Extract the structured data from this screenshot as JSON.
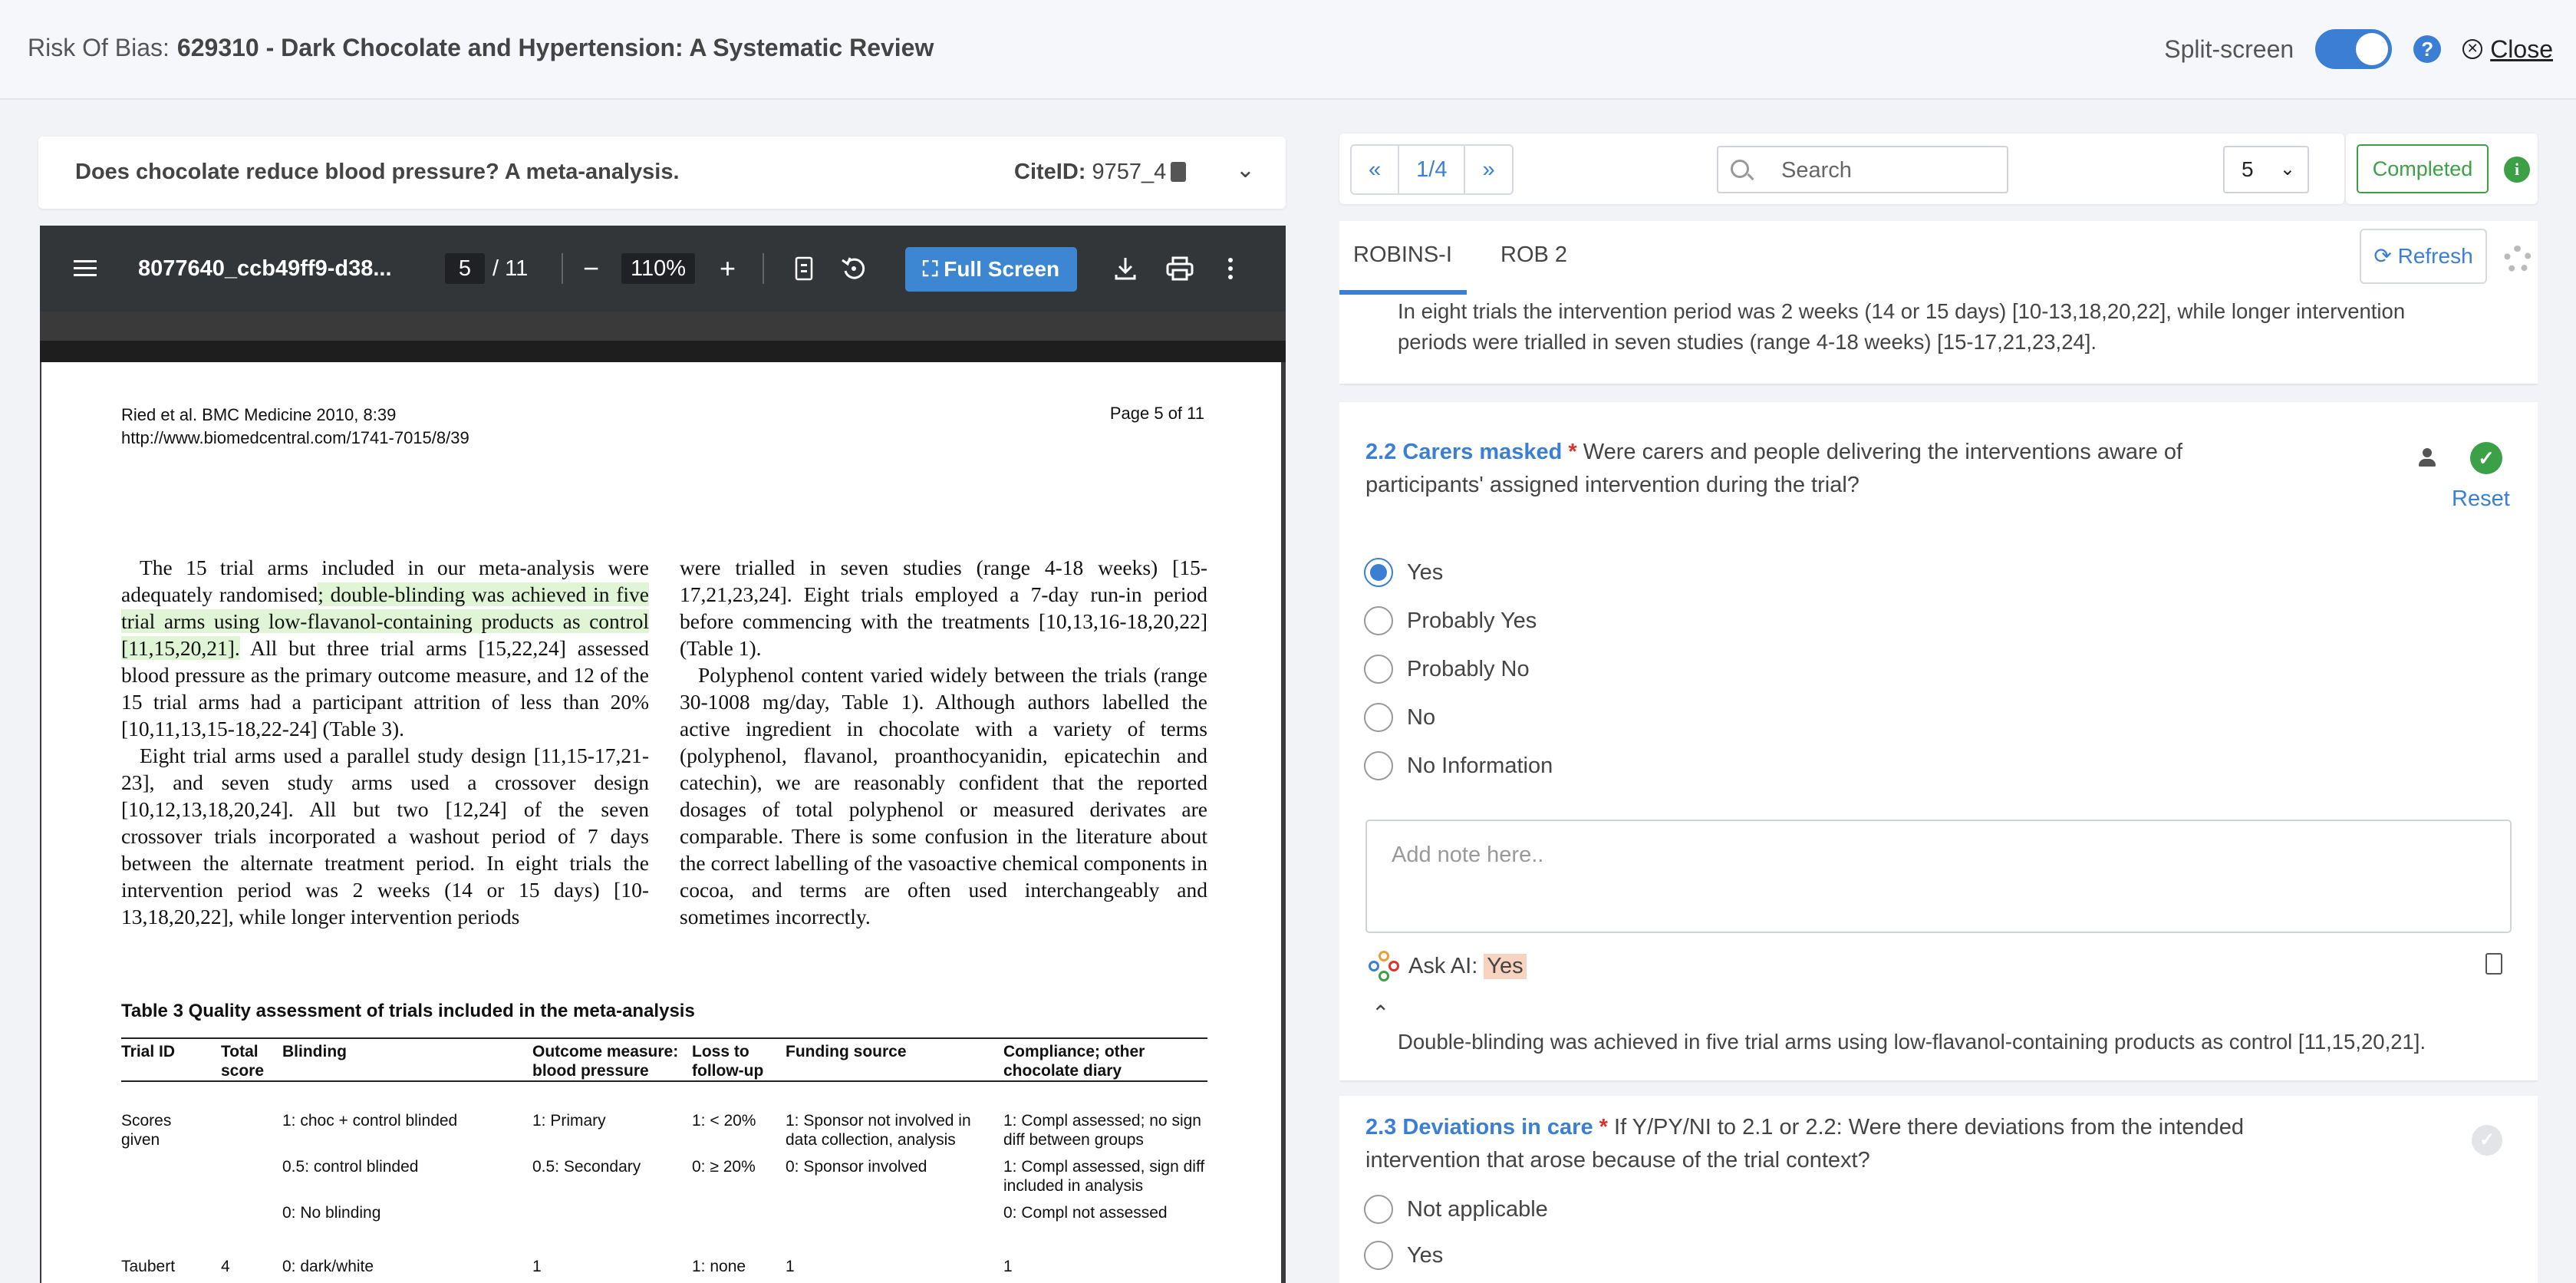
{
  "header": {
    "prefix": "Risk Of Bias:",
    "title": "629310 - Dark Chocolate and Hypertension: A Systematic Review",
    "split_label": "Split-screen",
    "help_glyph": "?",
    "close_label": "Close"
  },
  "citation": {
    "title": "Does chocolate reduce blood pressure? A meta-analysis.",
    "cite_label": "CiteID:",
    "cite_id": "9757_4"
  },
  "pdf": {
    "filename": "8077640_ccb49ff9-d38...",
    "page": "5",
    "total": "/ 11",
    "zoom": "110%",
    "fullscreen_label": "Full Screen",
    "page_header_l1": "Ried et al. BMC Medicine 2010, 8:39",
    "page_header_l2": "http://www.biomedcentral.com/1741-7015/8/39",
    "page_header_r": "Page 5 of 11",
    "col1_a": "The 15 trial arms included in our meta-analysis were adequately randomised",
    "col1_hl": "; double-blinding was achieved in five trial arms using low-flavanol-containing products as control [11,15,20,21].",
    "col1_b": " All but three trial arms [15,22,24] assessed blood pressure as the primary outcome measure, and 12 of the 15 trial arms had a participant attrition of less than 20% [10,11,13,15-18,22-24] (Table 3).",
    "col1_p2": "Eight trial arms used a parallel study design [11,15-17,21-23], and seven study arms used a crossover design [10,12,13,18,20,24]. All but two [12,24] of the seven crossover trials incorporated a washout period of 7 days between the alternate treatment period. In eight trials the intervention period was 2 weeks (14 or 15 days) [10-13,18,20,22], while longer intervention periods",
    "col2_p1": "were trialled in seven studies (range 4-18 weeks) [15-17,21,23,24]. Eight trials employed a 7-day run-in period before commencing with the treatments [10,13,16-18,20,22] (Table 1).",
    "col2_p2": "Polyphenol content varied widely between the trials (range 30-1008 mg/day, Table 1). Although authors labelled the active ingredient in chocolate with a variety of terms (polyphenol, flavanol, proanthocyanidin, epicatechin and catechin), we are reasonably confident that the reported dosages of total polyphenol or measured derivates are comparable. There is some confusion in the literature about the correct labelling of the vasoactive chemical components in cocoa, and terms are often used interchangeably and sometimes incorrectly.",
    "table_title": "Table 3 Quality assessment of trials included in the meta-analysis",
    "table_headers": [
      "Trial ID",
      "Total score",
      "Blinding",
      "Outcome measure: blood pressure",
      "Loss to follow-up",
      "Funding source",
      "Compliance; other chocolate diary"
    ],
    "table_rows": [
      [
        "Scores given",
        "",
        "1: choc + control blinded",
        "1: Primary",
        "1: < 20%",
        "1: Sponsor not involved in data collection, analysis",
        "1: Compl assessed; no sign diff between groups"
      ],
      [
        "",
        "",
        "0.5: control blinded",
        "0.5: Secondary",
        "0: ≥ 20%",
        "0: Sponsor involved",
        "1: Compl assessed, sign diff included in analysis"
      ],
      [
        "",
        "",
        "0: No blinding",
        "",
        "",
        "",
        "0: Compl not assessed"
      ],
      [
        "Taubert",
        "4",
        "0: dark/white",
        "1",
        "1: none",
        "1",
        "1"
      ]
    ]
  },
  "rob": {
    "pager": [
      "«",
      "1/4",
      "»"
    ],
    "search_placeholder": "Search",
    "select_value": "5",
    "status": "Completed",
    "info_glyph": "i",
    "tabs": [
      "ROBINS-I",
      "ROB 2"
    ],
    "refresh_label": "Refresh",
    "prev_answer": "In eight trials the intervention period was 2 weeks (14 or 15 days) [10-13,18,20,22], while longer intervention periods were trialled in seven studies (range 4-18 weeks) [15-17,21,23,24].",
    "q22": {
      "label": "2.2 Carers masked",
      "req": "*",
      "text": " Were carers and people delivering the interventions aware of participants' assigned intervention during the trial?",
      "reset": "Reset",
      "options": [
        "Yes",
        "Probably Yes",
        "Probably No",
        "No",
        "No Information"
      ],
      "selected": "Yes",
      "note_placeholder": "Add note here..",
      "ask_ai_label": "Ask AI:",
      "ask_ai_answer": "Yes",
      "ai_explanation": "Double-blinding was achieved in five trial arms using low-flavanol-containing products as control [11,15,20,21]."
    },
    "q23": {
      "label": "2.3 Deviations in care",
      "req": "*",
      "text": " If Y/PY/NI to 2.1 or 2.2: Were there deviations from the intended intervention that arose because of the trial context?",
      "options": [
        "Not applicable",
        "Yes"
      ]
    },
    "colors": {
      "accent": "#3b7fd4",
      "success": "#3ca046",
      "required": "#d9342b"
    }
  }
}
